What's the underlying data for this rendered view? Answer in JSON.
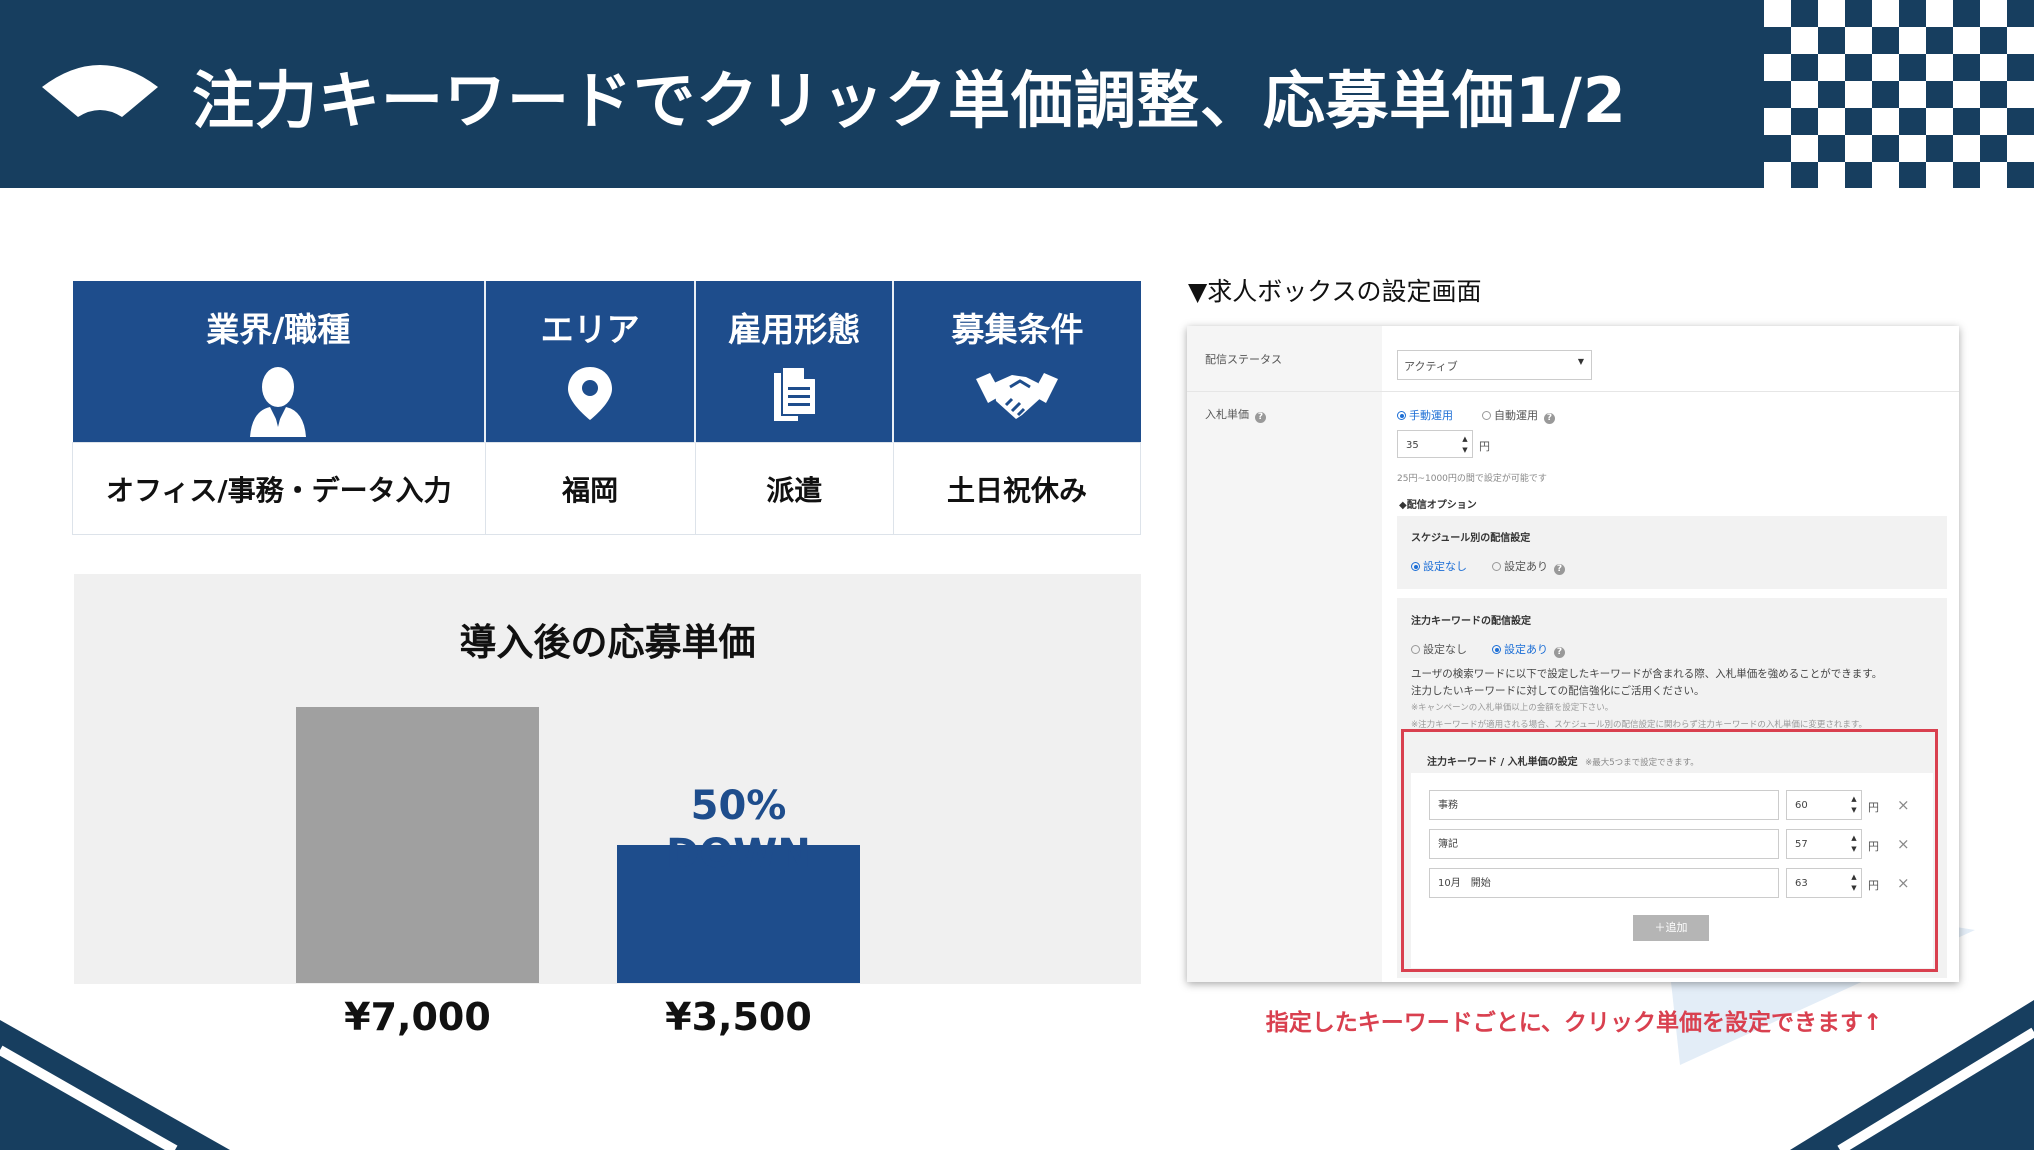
{
  "header": {
    "title": "注力キーワードでクリック単価調整、応募単価1/2",
    "colors": {
      "background": "#173e5f",
      "title": "#ffffff"
    },
    "icons": [
      "fan-icon",
      "checkerboard-pattern"
    ]
  },
  "job_table": {
    "columns": [
      {
        "label": "業界/職種",
        "icon": "person-icon",
        "value": "オフィス/事務・データ入力"
      },
      {
        "label": "エリア",
        "icon": "location-pin-icon",
        "value": "福岡"
      },
      {
        "label": "雇用形態",
        "icon": "document-icon",
        "value": "派遣"
      },
      {
        "label": "募集条件",
        "icon": "handshake-icon",
        "value": "土日祝休み"
      }
    ],
    "header_color": "#1e4d8c"
  },
  "chart_data": {
    "type": "bar",
    "title": "導入後の応募単価",
    "categories": [
      "¥7,000",
      "¥3,500"
    ],
    "values": [
      7000,
      3500
    ],
    "value_labels": [
      "¥7,000",
      "¥3,500"
    ],
    "bar_colors": [
      "#a0a0a0",
      "#1e4d8c"
    ],
    "annotation": {
      "line1": "50%",
      "line2": "DOWN",
      "color": "#1e4d8c"
    },
    "ylim": [
      0,
      7000
    ],
    "xlabel": "",
    "ylabel": "",
    "grid": false
  },
  "settings_screen": {
    "caption": "▼求人ボックスの設定画面",
    "status_label": "配信ステータス",
    "status_value": "アクティブ",
    "bid_label": "入札単価",
    "bid_manual": "手動運用",
    "bid_auto": "自動運用",
    "bid_value": "35",
    "yen": "円",
    "bid_range_note": "25円~1000円の間で設定が可能です",
    "options_heading": "◆配信オプション",
    "schedule_title": "スケジュール別の配信設定",
    "schedule_none": "設定なし",
    "schedule_some": "設定あり",
    "keyword_title": "注力キーワードの配信設定",
    "keyword_none": "設定なし",
    "keyword_some": "設定あり",
    "keyword_desc1": "ユーザの検索ワードに以下で設定したキーワードが含まれる際、入札単価を強めることができます。",
    "keyword_desc2": "注力したいキーワードに対しての配信強化にご活用ください。",
    "keyword_note1": "※キャンペーンの入札単価以上の金額を設定下さい。",
    "keyword_note2": "※注力キーワードが適用される場合、スケジュール別の配信設定に関わらず注力キーワードの入札単価に変更されます。",
    "kw_table_title": "注力キーワード / 入札単価の設定",
    "kw_table_note": "※最大5つまで設定できます。",
    "keywords": [
      {
        "word": "事務",
        "bid": "60"
      },
      {
        "word": "簿記",
        "bid": "57"
      },
      {
        "word": "10月　開始",
        "bid": "63"
      }
    ],
    "add_button": "＋追加",
    "highlight_color": "#d9404f"
  },
  "note": "指定したキーワードごとに、クリック単価を設定できます↑"
}
